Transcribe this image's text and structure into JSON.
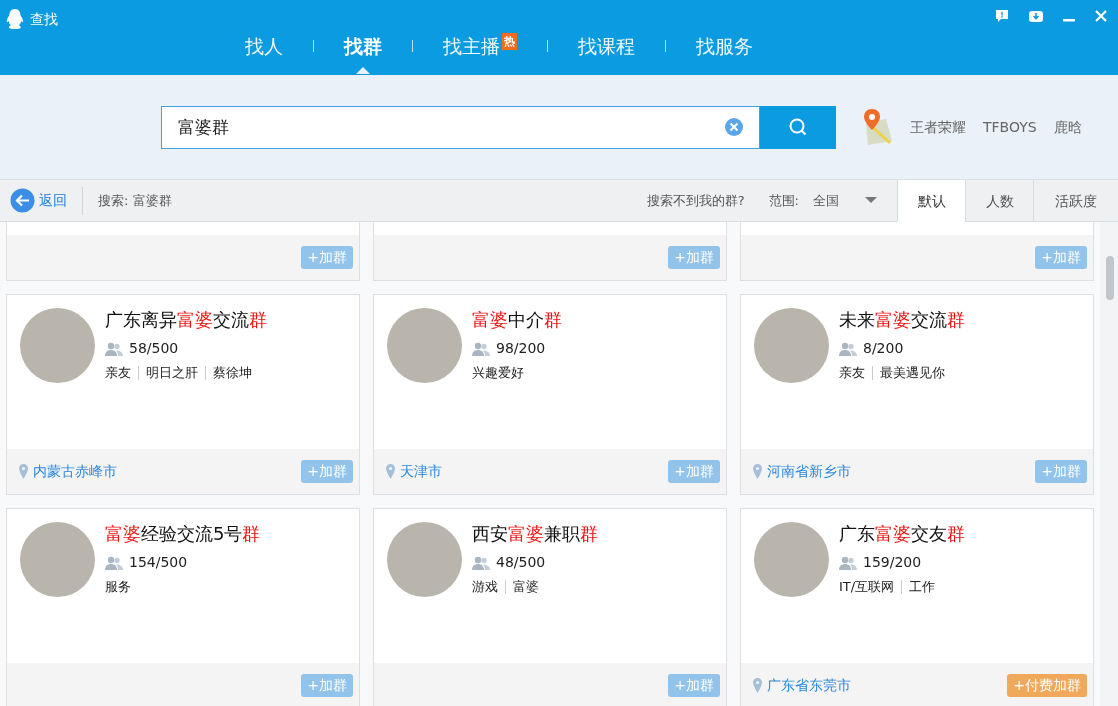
{
  "window": {
    "title": "查找"
  },
  "nav_tabs": [
    {
      "label": "找人",
      "selected": false
    },
    {
      "label": "找群",
      "selected": true
    },
    {
      "label": "找主播",
      "selected": false,
      "badge": "热"
    },
    {
      "label": "找课程",
      "selected": false
    },
    {
      "label": "找服务",
      "selected": false
    }
  ],
  "search": {
    "value": "富婆群"
  },
  "hot_keywords": [
    "王者荣耀",
    "TFBOYS",
    "鹿晗"
  ],
  "toolbar": {
    "back": "返回",
    "query": "搜索: 富婆群",
    "help_link": "搜索不到我的群?",
    "range_label": "范围:",
    "range_value": "全国",
    "sort_tabs": [
      {
        "label": "默认",
        "selected": true
      },
      {
        "label": "人数",
        "selected": false
      },
      {
        "label": "活跃度",
        "selected": false
      }
    ]
  },
  "partial_cards": [
    {
      "button": {
        "label": "+加群",
        "kind": "join"
      }
    },
    {
      "button": {
        "label": "+加群",
        "kind": "join"
      }
    },
    {
      "button": {
        "label": "+加群",
        "kind": "join"
      }
    }
  ],
  "cards": [
    {
      "name": [
        {
          "text": "广东离异",
          "highlight": false
        },
        {
          "text": "富婆",
          "highlight": true
        },
        {
          "text": "交流",
          "highlight": false
        },
        {
          "text": "群",
          "highlight": true
        }
      ],
      "members": "58/500",
      "tags": [
        "亲友",
        "明日之肝",
        "蔡徐坤"
      ],
      "location": "内蒙古赤峰市",
      "button": {
        "label": "+加群",
        "kind": "join"
      }
    },
    {
      "name": [
        {
          "text": "富婆",
          "highlight": true
        },
        {
          "text": "中介",
          "highlight": false
        },
        {
          "text": "群",
          "highlight": true
        }
      ],
      "members": "98/200",
      "tags": [
        "兴趣爱好"
      ],
      "location": "天津市",
      "button": {
        "label": "+加群",
        "kind": "join"
      }
    },
    {
      "name": [
        {
          "text": "未来",
          "highlight": false
        },
        {
          "text": "富婆",
          "highlight": true
        },
        {
          "text": "交流",
          "highlight": false
        },
        {
          "text": "群",
          "highlight": true
        }
      ],
      "members": "8/200",
      "tags": [
        "亲友",
        "最美遇见你"
      ],
      "location": "河南省新乡市",
      "button": {
        "label": "+加群",
        "kind": "join"
      }
    },
    {
      "name": [
        {
          "text": "富婆",
          "highlight": true
        },
        {
          "text": "经验交流5号",
          "highlight": false
        },
        {
          "text": "群",
          "highlight": true
        }
      ],
      "members": "154/500",
      "tags": [
        "服务"
      ],
      "button": {
        "label": "+加群",
        "kind": "join"
      }
    },
    {
      "name": [
        {
          "text": "西安",
          "highlight": false
        },
        {
          "text": "富婆",
          "highlight": true
        },
        {
          "text": "兼职",
          "highlight": false
        },
        {
          "text": "群",
          "highlight": true
        }
      ],
      "members": "48/500",
      "tags": [
        "游戏",
        "富婆"
      ],
      "button": {
        "label": "+加群",
        "kind": "join"
      }
    },
    {
      "name": [
        {
          "text": "广东",
          "highlight": false
        },
        {
          "text": "富婆",
          "highlight": true
        },
        {
          "text": "交友",
          "highlight": false
        },
        {
          "text": "群",
          "highlight": true
        }
      ],
      "members": "159/200",
      "tags": [
        "IT/互联网",
        "工作"
      ],
      "location": "广东省东莞市",
      "button": {
        "label": "+付费加群",
        "kind": "paid"
      }
    }
  ]
}
